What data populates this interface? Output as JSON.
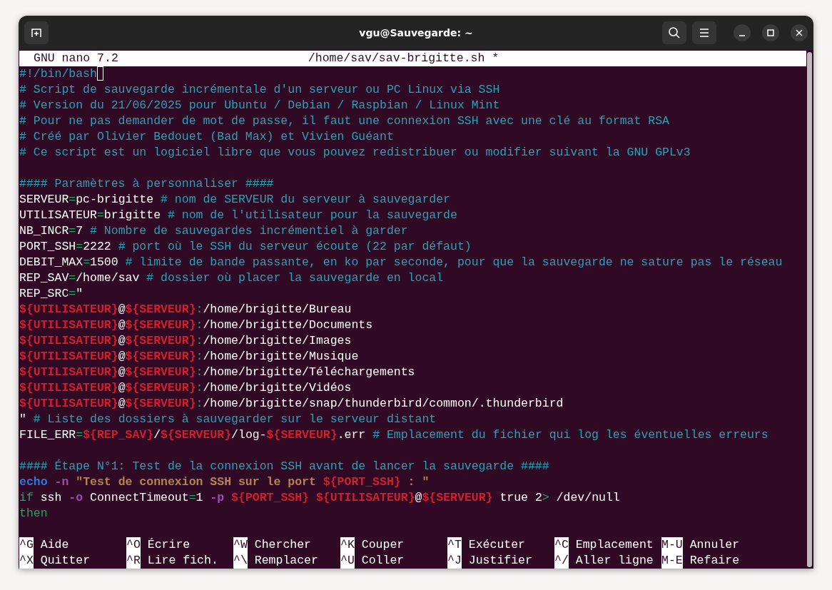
{
  "window": {
    "title": "vgu@Sauvegarde: ~"
  },
  "nano_header": {
    "version": "GNU nano 7.2",
    "file": "/home/sav/sav-brigitte.sh *"
  },
  "lines": [
    {
      "kind": "code",
      "cursor": true,
      "segments": [
        {
          "kind": "comment",
          "text": "#!/bin/bash"
        }
      ]
    },
    {
      "kind": "code",
      "cursor": false,
      "segments": [
        {
          "kind": "comment",
          "text": "# Script de sauvegarde incrémentale d'un serveur ou PC Linux via SSH"
        }
      ]
    },
    {
      "kind": "code",
      "cursor": false,
      "segments": [
        {
          "kind": "comment",
          "text": "# Version du 21/06/2025 pour Ubuntu / Debian / Raspbian / Linux Mint"
        }
      ]
    },
    {
      "kind": "code",
      "cursor": false,
      "segments": [
        {
          "kind": "comment",
          "text": "# Pour ne pas demander de mot de passe, il faut une connexion SSH avec une clé au format RSA"
        }
      ]
    },
    {
      "kind": "code",
      "cursor": false,
      "segments": [
        {
          "kind": "comment",
          "text": "# Créé par Olivier Bedouet (Bad Max) et Vivien Guéant"
        }
      ]
    },
    {
      "kind": "code",
      "cursor": false,
      "segments": [
        {
          "kind": "comment",
          "text": "# Ce script est un logiciel libre que vous pouvez redistribuer ou modifier suivant la GNU GPLv3"
        }
      ]
    },
    {
      "kind": "blank",
      "cursor": false
    },
    {
      "kind": "code",
      "cursor": false,
      "segments": [
        {
          "kind": "comment",
          "text": "#### Paramètres à personnaliser ####"
        }
      ]
    },
    {
      "kind": "code",
      "cursor": false,
      "segments": [
        {
          "kind": "text",
          "text": "SERVEUR"
        },
        {
          "kind": "op",
          "text": "="
        },
        {
          "kind": "text",
          "text": "pc-brigitte "
        },
        {
          "kind": "comment",
          "text": "# nom de SERVEUR du serveur à sauvegarder"
        }
      ]
    },
    {
      "kind": "code",
      "cursor": false,
      "segments": [
        {
          "kind": "text",
          "text": "UTILISATEUR"
        },
        {
          "kind": "op",
          "text": "="
        },
        {
          "kind": "text",
          "text": "brigitte "
        },
        {
          "kind": "comment",
          "text": "# nom de l'utilisateur pour la sauvegarde"
        }
      ]
    },
    {
      "kind": "code",
      "cursor": false,
      "segments": [
        {
          "kind": "text",
          "text": "NB_INCR"
        },
        {
          "kind": "op",
          "text": "="
        },
        {
          "kind": "text",
          "text": "7 "
        },
        {
          "kind": "comment",
          "text": "# Nombre de sauvegardes incrémentiel à garder"
        }
      ]
    },
    {
      "kind": "code",
      "cursor": false,
      "segments": [
        {
          "kind": "text",
          "text": "PORT_SSH"
        },
        {
          "kind": "op",
          "text": "="
        },
        {
          "kind": "text",
          "text": "2222 "
        },
        {
          "kind": "comment",
          "text": "# port où le SSH du serveur écoute (22 par défaut)"
        }
      ]
    },
    {
      "kind": "code",
      "cursor": false,
      "segments": [
        {
          "kind": "text",
          "text": "DEBIT_MAX"
        },
        {
          "kind": "op",
          "text": "="
        },
        {
          "kind": "text",
          "text": "1500 "
        },
        {
          "kind": "comment",
          "text": "# limite de bande passante, en ko par seconde, pour que la sauvegarde ne sature pas le réseau"
        }
      ]
    },
    {
      "kind": "code",
      "cursor": false,
      "segments": [
        {
          "kind": "text",
          "text": "REP_SAV"
        },
        {
          "kind": "op",
          "text": "="
        },
        {
          "kind": "text",
          "text": "/home/sav "
        },
        {
          "kind": "comment",
          "text": "# dossier où placer la sauvegarde en local"
        }
      ]
    },
    {
      "kind": "code",
      "cursor": false,
      "segments": [
        {
          "kind": "text",
          "text": "REP_SRC"
        },
        {
          "kind": "op",
          "text": "="
        },
        {
          "kind": "text",
          "text": "\""
        }
      ]
    },
    {
      "kind": "code",
      "cursor": false,
      "segments": [
        {
          "kind": "var",
          "text": "${UTILISATEUR}"
        },
        {
          "kind": "text",
          "text": "@"
        },
        {
          "kind": "var",
          "text": "${SERVEUR}"
        },
        {
          "kind": "op",
          "text": ":"
        },
        {
          "kind": "text",
          "text": "/home/brigitte/Bureau"
        }
      ]
    },
    {
      "kind": "code",
      "cursor": false,
      "segments": [
        {
          "kind": "var",
          "text": "${UTILISATEUR}"
        },
        {
          "kind": "text",
          "text": "@"
        },
        {
          "kind": "var",
          "text": "${SERVEUR}"
        },
        {
          "kind": "op",
          "text": ":"
        },
        {
          "kind": "text",
          "text": "/home/brigitte/Documents"
        }
      ]
    },
    {
      "kind": "code",
      "cursor": false,
      "segments": [
        {
          "kind": "var",
          "text": "${UTILISATEUR}"
        },
        {
          "kind": "text",
          "text": "@"
        },
        {
          "kind": "var",
          "text": "${SERVEUR}"
        },
        {
          "kind": "op",
          "text": ":"
        },
        {
          "kind": "text",
          "text": "/home/brigitte/Images"
        }
      ]
    },
    {
      "kind": "code",
      "cursor": false,
      "segments": [
        {
          "kind": "var",
          "text": "${UTILISATEUR}"
        },
        {
          "kind": "text",
          "text": "@"
        },
        {
          "kind": "var",
          "text": "${SERVEUR}"
        },
        {
          "kind": "op",
          "text": ":"
        },
        {
          "kind": "text",
          "text": "/home/brigitte/Musique"
        }
      ]
    },
    {
      "kind": "code",
      "cursor": false,
      "segments": [
        {
          "kind": "var",
          "text": "${UTILISATEUR}"
        },
        {
          "kind": "text",
          "text": "@"
        },
        {
          "kind": "var",
          "text": "${SERVEUR}"
        },
        {
          "kind": "op",
          "text": ":"
        },
        {
          "kind": "text",
          "text": "/home/brigitte/Téléchargements"
        }
      ]
    },
    {
      "kind": "code",
      "cursor": false,
      "segments": [
        {
          "kind": "var",
          "text": "${UTILISATEUR}"
        },
        {
          "kind": "text",
          "text": "@"
        },
        {
          "kind": "var",
          "text": "${SERVEUR}"
        },
        {
          "kind": "op",
          "text": ":"
        },
        {
          "kind": "text",
          "text": "/home/brigitte/Vidéos"
        }
      ]
    },
    {
      "kind": "code",
      "cursor": false,
      "segments": [
        {
          "kind": "var",
          "text": "${UTILISATEUR}"
        },
        {
          "kind": "text",
          "text": "@"
        },
        {
          "kind": "var",
          "text": "${SERVEUR}"
        },
        {
          "kind": "op",
          "text": ":"
        },
        {
          "kind": "text",
          "text": "/home/brigitte/snap/thunderbird/common/.thunderbird"
        }
      ]
    },
    {
      "kind": "code",
      "cursor": false,
      "segments": [
        {
          "kind": "text",
          "text": "\" "
        },
        {
          "kind": "comment",
          "text": "# Liste des dossiers à sauvegarder sur le serveur distant"
        }
      ]
    },
    {
      "kind": "code",
      "cursor": false,
      "segments": [
        {
          "kind": "text",
          "text": "FILE_ERR"
        },
        {
          "kind": "op",
          "text": "="
        },
        {
          "kind": "var",
          "text": "${REP_SAV}"
        },
        {
          "kind": "text",
          "text": "/"
        },
        {
          "kind": "var",
          "text": "${SERVEUR}"
        },
        {
          "kind": "text",
          "text": "/log-"
        },
        {
          "kind": "var",
          "text": "${SERVEUR}"
        },
        {
          "kind": "text",
          "text": ".err "
        },
        {
          "kind": "comment",
          "text": "# Emplacement du fichier qui log les éventuelles erreurs"
        }
      ]
    },
    {
      "kind": "blank",
      "cursor": false
    },
    {
      "kind": "code",
      "cursor": false,
      "segments": [
        {
          "kind": "comment",
          "text": "#### Étape N°1: Test de la connexion SSH avant de lancer la sauvegarde ####"
        }
      ]
    },
    {
      "kind": "code",
      "cursor": false,
      "segments": [
        {
          "kind": "builtin",
          "text": "echo"
        },
        {
          "kind": "flag",
          "text": " -n"
        },
        {
          "kind": "string",
          "text": " \"Test de connexion SSH sur le port "
        },
        {
          "kind": "var",
          "text": "${PORT_SSH}"
        },
        {
          "kind": "string",
          "text": " : \""
        }
      ]
    },
    {
      "kind": "code",
      "cursor": false,
      "segments": [
        {
          "kind": "keyword",
          "text": "if"
        },
        {
          "kind": "text",
          "text": " ssh "
        },
        {
          "kind": "flag",
          "text": "-o"
        },
        {
          "kind": "text",
          "text": " ConnectTimeout"
        },
        {
          "kind": "op",
          "text": "="
        },
        {
          "kind": "text",
          "text": "1 "
        },
        {
          "kind": "flag",
          "text": "-p"
        },
        {
          "kind": "var",
          "text": " ${PORT_SSH}"
        },
        {
          "kind": "var",
          "text": " ${UTILISATEUR}"
        },
        {
          "kind": "text",
          "text": "@"
        },
        {
          "kind": "var",
          "text": "${SERVEUR}"
        },
        {
          "kind": "text",
          "text": " true 2"
        },
        {
          "kind": "op",
          "text": ">"
        },
        {
          "kind": "text",
          "text": " /dev/null"
        }
      ]
    },
    {
      "kind": "code",
      "cursor": false,
      "segments": [
        {
          "kind": "keyword",
          "text": "then"
        }
      ]
    }
  ],
  "shortcut_rows": [
    [
      {
        "key": "^G",
        "label": "Aide"
      },
      {
        "key": "^O",
        "label": "Écrire"
      },
      {
        "key": "^W",
        "label": "Chercher"
      },
      {
        "key": "^K",
        "label": "Couper"
      },
      {
        "key": "^T",
        "label": "Exécuter"
      },
      {
        "key": "^C",
        "label": "Emplacement"
      },
      {
        "key": "M-U",
        "label": "Annuler"
      }
    ],
    [
      {
        "key": "^X",
        "label": "Quitter"
      },
      {
        "key": "^R",
        "label": "Lire fich."
      },
      {
        "key": "^\\",
        "label": "Remplacer"
      },
      {
        "key": "^U",
        "label": "Coller"
      },
      {
        "key": "^J",
        "label": "Justifier"
      },
      {
        "key": "^/",
        "label": "Aller ligne"
      },
      {
        "key": "M-E",
        "label": "Refaire"
      }
    ]
  ]
}
